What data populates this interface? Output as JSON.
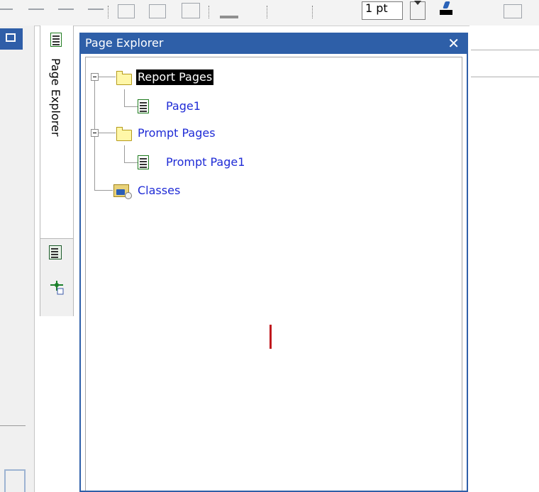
{
  "toolbar": {
    "font_size": "1 pt",
    "font_size_dropdown_icon": "chevron-down-icon",
    "border_color_icon": "pen-color-icon"
  },
  "left_panel": {
    "top_button_icon": "window-icon"
  },
  "tab_strip": {
    "page_explorer_tab": "Page Explorer",
    "page_explorer_tab_icon": "page-explorer-icon",
    "insertable_objects_icon": "insertable-objects-icon",
    "query_explorer_icon": "query-explorer-icon"
  },
  "pane": {
    "title": "Page Explorer",
    "close_label": "✕",
    "accent_color": "#2e5fa8"
  },
  "tree": {
    "report_pages": {
      "label": "Report Pages",
      "icon": "folder-icon"
    },
    "page1": {
      "label": "Page1",
      "icon": "page-icon"
    },
    "prompt_pages": {
      "label": "Prompt Pages",
      "icon": "folder-icon"
    },
    "prompt_page1": {
      "label": "Prompt Page1",
      "icon": "page-icon"
    },
    "classes": {
      "label": "Classes",
      "icon": "classes-icon"
    }
  }
}
